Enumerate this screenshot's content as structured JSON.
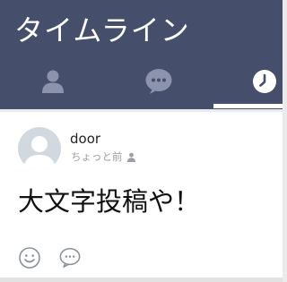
{
  "header": {
    "title": "タイムライン",
    "background": "#454e6b",
    "tabs": [
      {
        "id": "friends",
        "icon": "person-icon",
        "selected": false
      },
      {
        "id": "chats",
        "icon": "chat-bubble-icon",
        "selected": false
      },
      {
        "id": "timeline",
        "icon": "clock-icon",
        "selected": true
      }
    ]
  },
  "post": {
    "author": "door",
    "time": "ちょっと前",
    "visibility_icon": "person-small-icon",
    "body": "大文字投稿や！",
    "actions": [
      {
        "id": "like",
        "icon": "smiley-icon"
      },
      {
        "id": "comment",
        "icon": "comment-bubble-icon"
      }
    ]
  }
}
